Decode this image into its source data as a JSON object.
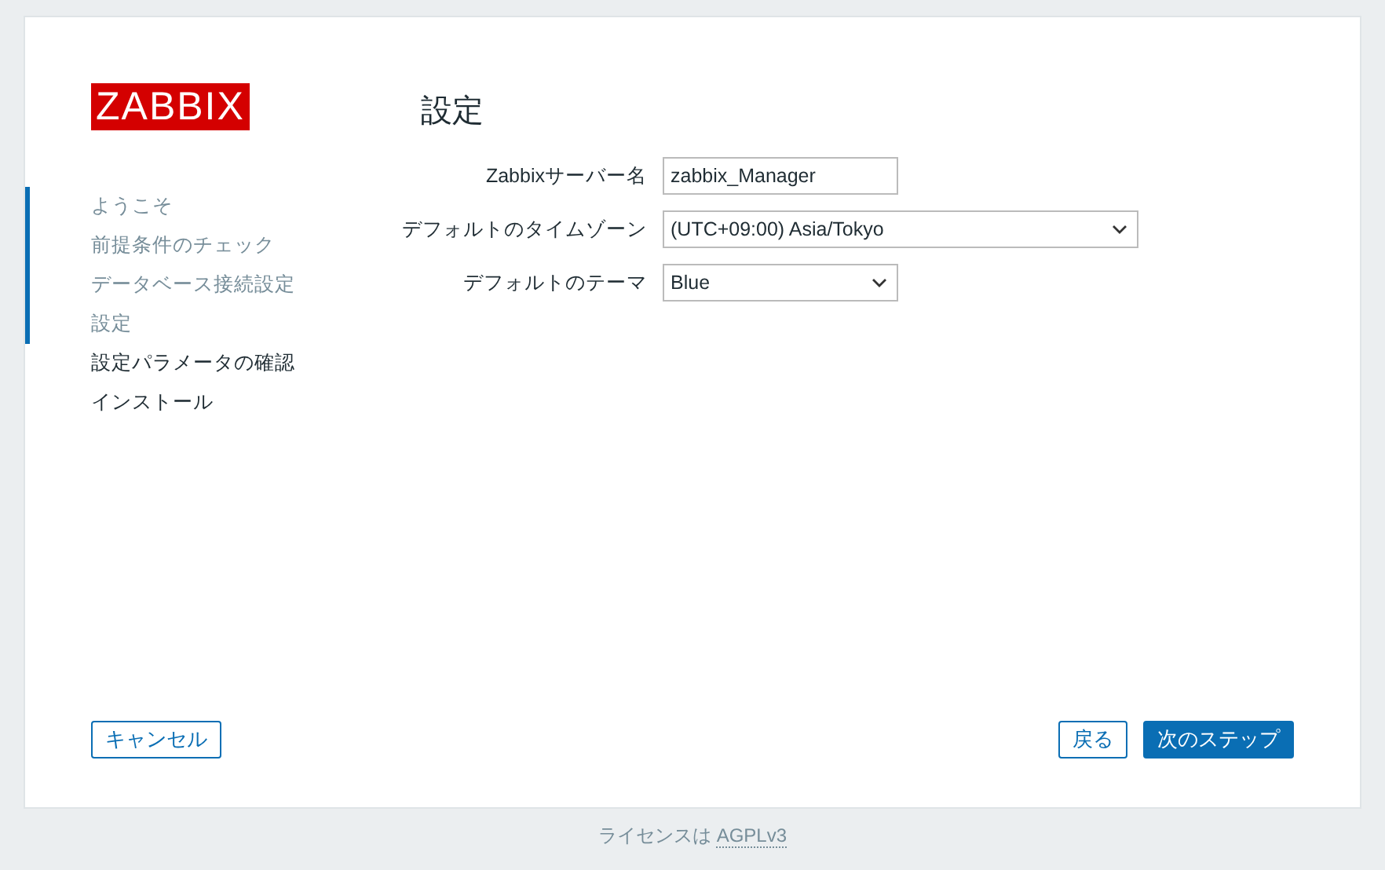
{
  "logo": "ZABBIX",
  "steps": [
    {
      "label": "ようこそ",
      "done": true
    },
    {
      "label": "前提条件のチェック",
      "done": true
    },
    {
      "label": "データベース接続設定",
      "done": true
    },
    {
      "label": "設定",
      "done": true
    },
    {
      "label": "設定パラメータの確認",
      "done": false
    },
    {
      "label": "インストール",
      "done": false
    }
  ],
  "title": "設定",
  "fields": [
    {
      "label": "Zabbixサーバー名",
      "kind": "text",
      "value": "zabbix_Manager"
    },
    {
      "label": "デフォルトのタイムゾーン",
      "kind": "wide-select",
      "value": "(UTC+09:00) Asia/Tokyo"
    },
    {
      "label": "デフォルトのテーマ",
      "kind": "select",
      "value": "Blue"
    }
  ],
  "buttons": {
    "cancel": "キャンセル",
    "back": "戻る",
    "next": "次のステップ"
  },
  "footer": {
    "text": "ライセンスは",
    "link": "AGPLv3"
  }
}
